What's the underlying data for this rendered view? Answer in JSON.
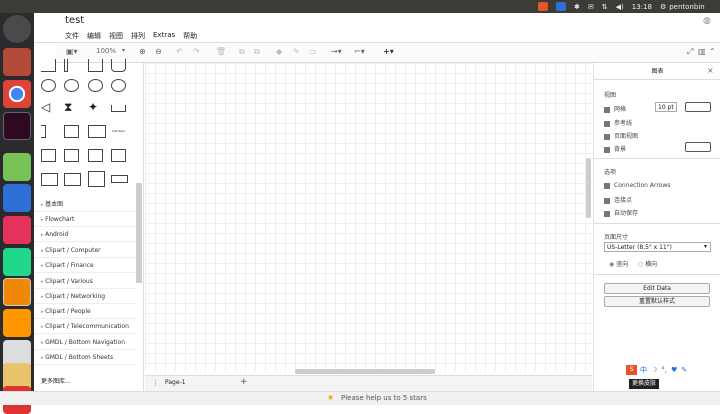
{
  "system": {
    "time": "13:18",
    "user": "pentonbin"
  },
  "app": {
    "title": "test",
    "menu": [
      "文件",
      "编辑",
      "视图",
      "排列",
      "Extras",
      "帮助"
    ],
    "zoom": "100%"
  },
  "library": {
    "sections": [
      "基本图",
      "Flowchart",
      "Android",
      "Clipart / Computer",
      "Clipart / Finance",
      "Clipart / Various",
      "Clipart / Networking",
      "Clipart / People",
      "Clipart / Telecommunication",
      "GMDL / Bottom Navigation",
      "GMDL / Bottom Sheets"
    ],
    "more": "更多图库...",
    "list_item_label": "List Item"
  },
  "format_panel": {
    "title": "图表",
    "view_heading": "视图",
    "view_items": [
      "网格",
      "参考线",
      "页面视图",
      "背景"
    ],
    "grid_size": "10 pt",
    "options_heading": "选项",
    "options_items": [
      "Connection Arrows",
      "连接点",
      "自动保存"
    ],
    "page_size_heading": "页面尺寸",
    "page_size_value": "US-Letter (8,5\" x 11\")",
    "orientation": [
      "竖向",
      "横向"
    ],
    "edit_data": "Edit Data",
    "reset_style": "重置默认样式"
  },
  "page_tab": "Page-1",
  "ime": {
    "tooltip": "更换皮肤"
  },
  "footer": {
    "message": "Please help us to 5 stars"
  }
}
